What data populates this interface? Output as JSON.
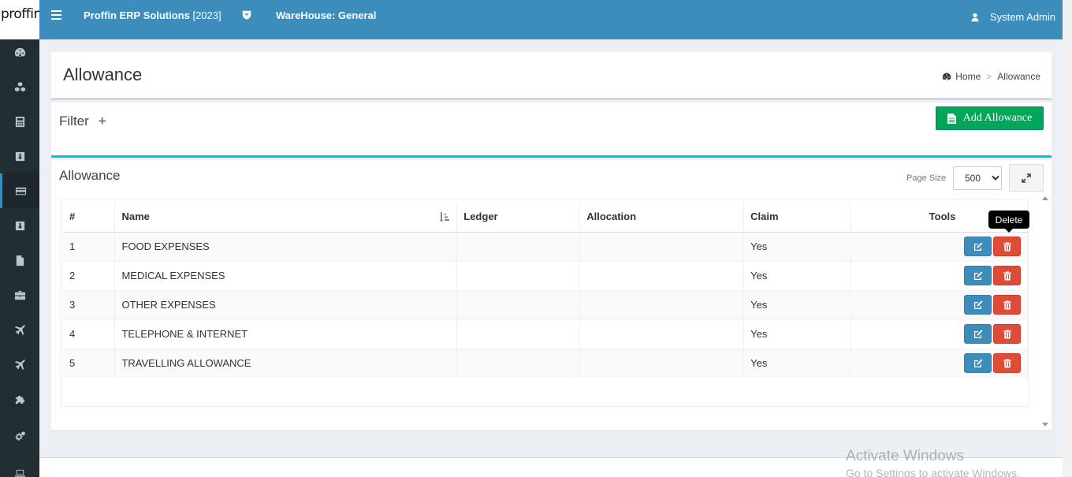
{
  "app": {
    "logo_text": "proffin",
    "brand": "Proffin ERP Solutions",
    "year": "[2023]",
    "warehouse": "WareHouse: General",
    "user": "System Admin"
  },
  "sidebar": {
    "items": [
      {
        "name": "dashboard-icon"
      },
      {
        "name": "cubes-icon"
      },
      {
        "name": "calculator-icon"
      },
      {
        "name": "download-icon"
      },
      {
        "name": "credit-card-icon",
        "active": true
      },
      {
        "name": "download-icon-2"
      },
      {
        "name": "file-icon"
      },
      {
        "name": "briefcase-icon"
      },
      {
        "name": "plane-icon"
      },
      {
        "name": "plane-icon-2"
      },
      {
        "name": "puzzle-icon"
      },
      {
        "name": "cogs-icon"
      },
      {
        "name": "laptop-icon"
      }
    ]
  },
  "page": {
    "title": "Allowance",
    "breadcrumb": {
      "home": "Home",
      "sep": ">",
      "current": "Allowance"
    }
  },
  "filter": {
    "title": "Filter",
    "plus": "+",
    "add_button": "Add Allowance"
  },
  "list": {
    "title": "Allowance",
    "page_size_label": "Page Size",
    "page_size_value": "500",
    "columns": [
      "#",
      "Name",
      "Ledger",
      "Allocation",
      "Claim",
      "Tools"
    ],
    "rows": [
      {
        "no": "1",
        "name": "FOOD EXPENSES",
        "ledger": "",
        "allocation": "",
        "claim": "Yes"
      },
      {
        "no": "2",
        "name": "MEDICAL EXPENSES",
        "ledger": "",
        "allocation": "",
        "claim": "Yes"
      },
      {
        "no": "3",
        "name": "OTHER EXPENSES",
        "ledger": "",
        "allocation": "",
        "claim": "Yes"
      },
      {
        "no": "4",
        "name": "TELEPHONE & INTERNET",
        "ledger": "",
        "allocation": "",
        "claim": "Yes"
      },
      {
        "no": "5",
        "name": "TRAVELLING ALLOWANCE",
        "ledger": "",
        "allocation": "",
        "claim": "Yes"
      }
    ],
    "tooltip": "Delete"
  },
  "watermark": {
    "line1": "Activate Windows",
    "line2": "Go to Settings to activate Windows."
  },
  "colors": {
    "header": "#3c8dbc",
    "sidebar": "#222d32",
    "success": "#00a65a",
    "danger": "#dd4b39",
    "info_border": "#00c0ef"
  }
}
